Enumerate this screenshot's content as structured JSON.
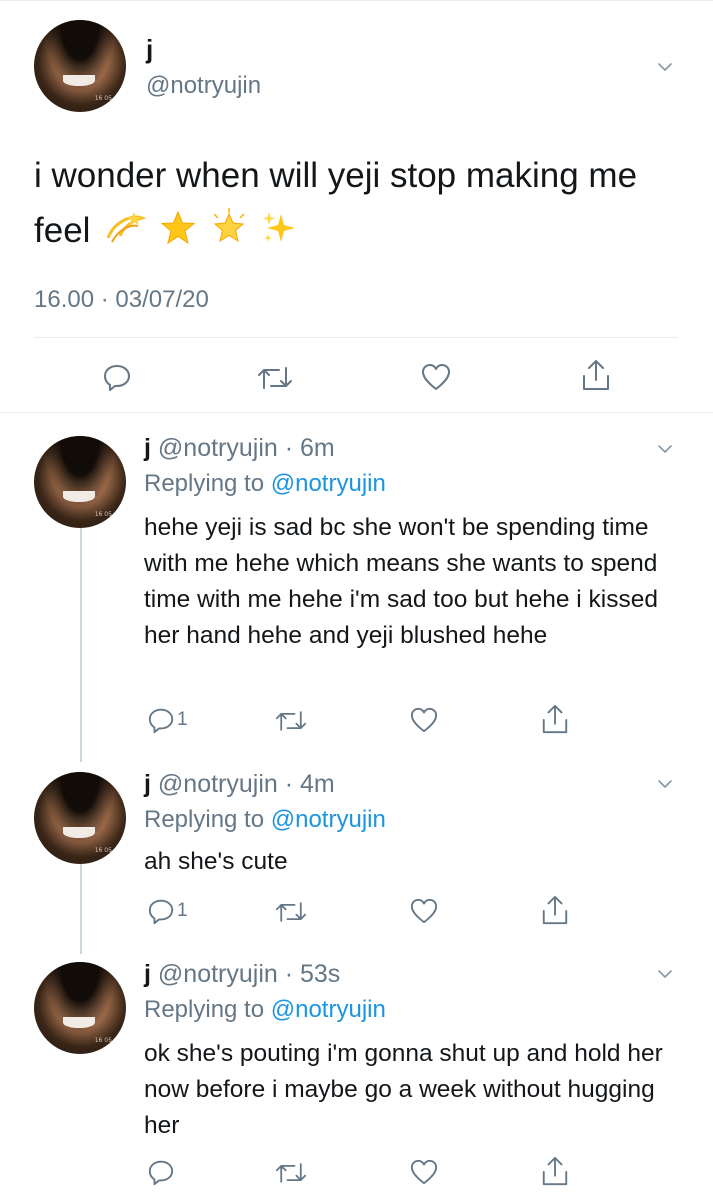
{
  "main_tweet": {
    "display_name": "j",
    "handle": "@notryujin",
    "text": "i wonder when will yeji stop making me feel",
    "emojis": [
      "dizzy-emoji",
      "star-emoji",
      "glowing-star-emoji",
      "sparkles-emoji"
    ],
    "timestamp": "16.00 · 03/07/20"
  },
  "replies": [
    {
      "display_name": "j",
      "handle_time": "@notryujin · 6m",
      "replying_label": "Replying to",
      "replying_to": "@notryujin",
      "text": "hehe yeji is sad bc she won't be spending time with me hehe which means she wants to spend time with me hehe i'm sad too but hehe i kissed her hand hehe and yeji blushed hehe",
      "reply_count": "1"
    },
    {
      "display_name": "j",
      "handle_time": "@notryujin · 4m",
      "replying_label": "Replying to",
      "replying_to": "@notryujin",
      "text": "ah she's cute",
      "reply_count": "1"
    },
    {
      "display_name": "j",
      "handle_time": "@notryujin · 53s",
      "replying_label": "Replying to",
      "replying_to": "@notryujin",
      "text": "ok she's pouting i'm gonna shut up and hold her now before i maybe go a week without hugging her",
      "reply_count": ""
    }
  ],
  "icons": {
    "reply": "reply-icon",
    "retweet": "retweet-icon",
    "like": "like-icon",
    "share": "share-icon",
    "more": "chevron-down-icon"
  },
  "colors": {
    "text": "#14171a",
    "secondary": "#657786",
    "link": "#1b95e0",
    "divider": "#e6ecf0"
  }
}
